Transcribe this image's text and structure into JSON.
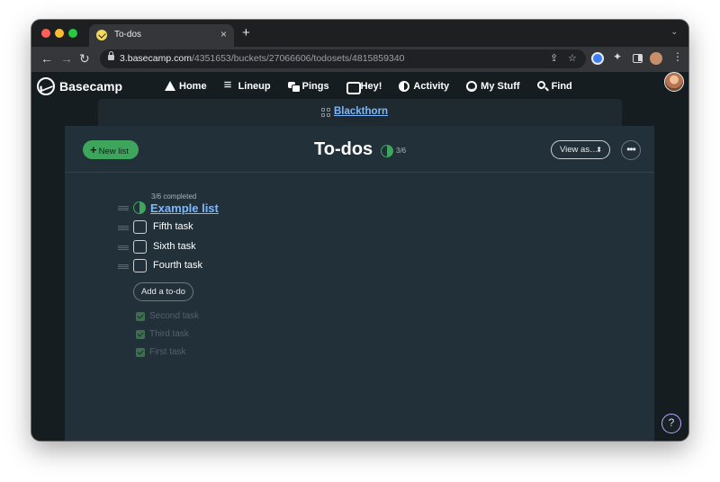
{
  "browser": {
    "tab_title": "To-dos",
    "tab_close": "×",
    "new_tab": "+",
    "tab_menu": "⌄",
    "url_domain": "3.basecamp.com",
    "url_path": "/4351653/buckets/27066606/todosets/4815859340",
    "back": "←",
    "forward": "→",
    "reload": "↻",
    "share_icon": "⇪",
    "star_icon": "☆",
    "puzzle_icon": "✦",
    "menu_icon": "⋮"
  },
  "app": {
    "logo": "Basecamp",
    "nav": [
      {
        "label": "Home",
        "icon": "home-icon"
      },
      {
        "label": "Lineup",
        "icon": "lineup-icon"
      },
      {
        "label": "Pings",
        "icon": "pings-icon"
      },
      {
        "label": "Hey!",
        "icon": "hey-icon"
      },
      {
        "label": "Activity",
        "icon": "activity-icon"
      },
      {
        "label": "My Stuff",
        "icon": "mystuff-icon"
      },
      {
        "label": "Find",
        "icon": "find-icon"
      }
    ],
    "project": "Blackthorn"
  },
  "page": {
    "title": "To-dos",
    "completed_ratio": "3/6",
    "new_list_label": "New list",
    "view_as_label": "View as…",
    "more_label": "•••"
  },
  "list": {
    "meta": "3/6 completed",
    "title": "Example list",
    "open_todos": [
      "Fifth task",
      "Sixth task",
      "Fourth task"
    ],
    "add_todo_label": "Add a to-do",
    "completed_todos": [
      "Second task",
      "Third task",
      "First task"
    ]
  },
  "help_label": "?",
  "colors": {
    "accent_green": "#3da65c",
    "link_blue": "#7cb8ff",
    "background": "#161d20",
    "card": "#22303a"
  }
}
